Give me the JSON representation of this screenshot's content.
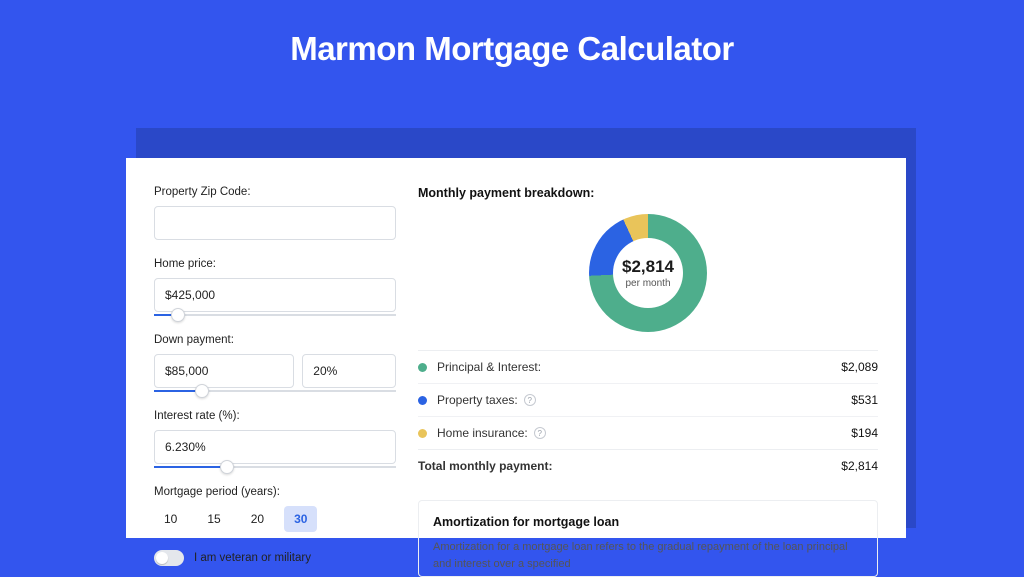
{
  "title": "Marmon Mortgage Calculator",
  "colors": {
    "green": "#4eae8c",
    "blue": "#2b63e3",
    "yellow": "#e9c45a"
  },
  "form": {
    "zip_label": "Property Zip Code:",
    "zip_value": "",
    "home_price_label": "Home price:",
    "home_price_value": "$425,000",
    "home_price_slider_pct": 10,
    "down_payment_label": "Down payment:",
    "down_payment_value": "$85,000",
    "down_payment_pct_value": "20%",
    "down_payment_slider_pct": 20,
    "interest_label": "Interest rate (%):",
    "interest_value": "6.230%",
    "interest_slider_pct": 30,
    "period_label": "Mortgage period (years):",
    "periods": [
      "10",
      "15",
      "20",
      "30"
    ],
    "period_selected": "30",
    "veteran_label": "I am veteran or military"
  },
  "breakdown": {
    "title": "Monthly payment breakdown:",
    "center_amount": "$2,814",
    "center_sub": "per month",
    "items": [
      {
        "label": "Principal & Interest:",
        "value": "$2,089",
        "color": "green",
        "help": false,
        "raw": 2089
      },
      {
        "label": "Property taxes:",
        "value": "$531",
        "color": "blue",
        "help": true,
        "raw": 531
      },
      {
        "label": "Home insurance:",
        "value": "$194",
        "color": "yellow",
        "help": true,
        "raw": 194
      }
    ],
    "total_label": "Total monthly payment:",
    "total_value": "$2,814"
  },
  "amort": {
    "title": "Amortization for mortgage loan",
    "text": "Amortization for a mortgage loan refers to the gradual repayment of the loan principal and interest over a specified"
  },
  "chart_data": {
    "type": "pie",
    "title": "Monthly payment breakdown",
    "series": [
      {
        "name": "Principal & Interest",
        "value": 2089,
        "color": "#4eae8c"
      },
      {
        "name": "Property taxes",
        "value": 531,
        "color": "#2b63e3"
      },
      {
        "name": "Home insurance",
        "value": 194,
        "color": "#e9c45a"
      }
    ],
    "total": 2814,
    "center_label": "$2,814 per month"
  }
}
